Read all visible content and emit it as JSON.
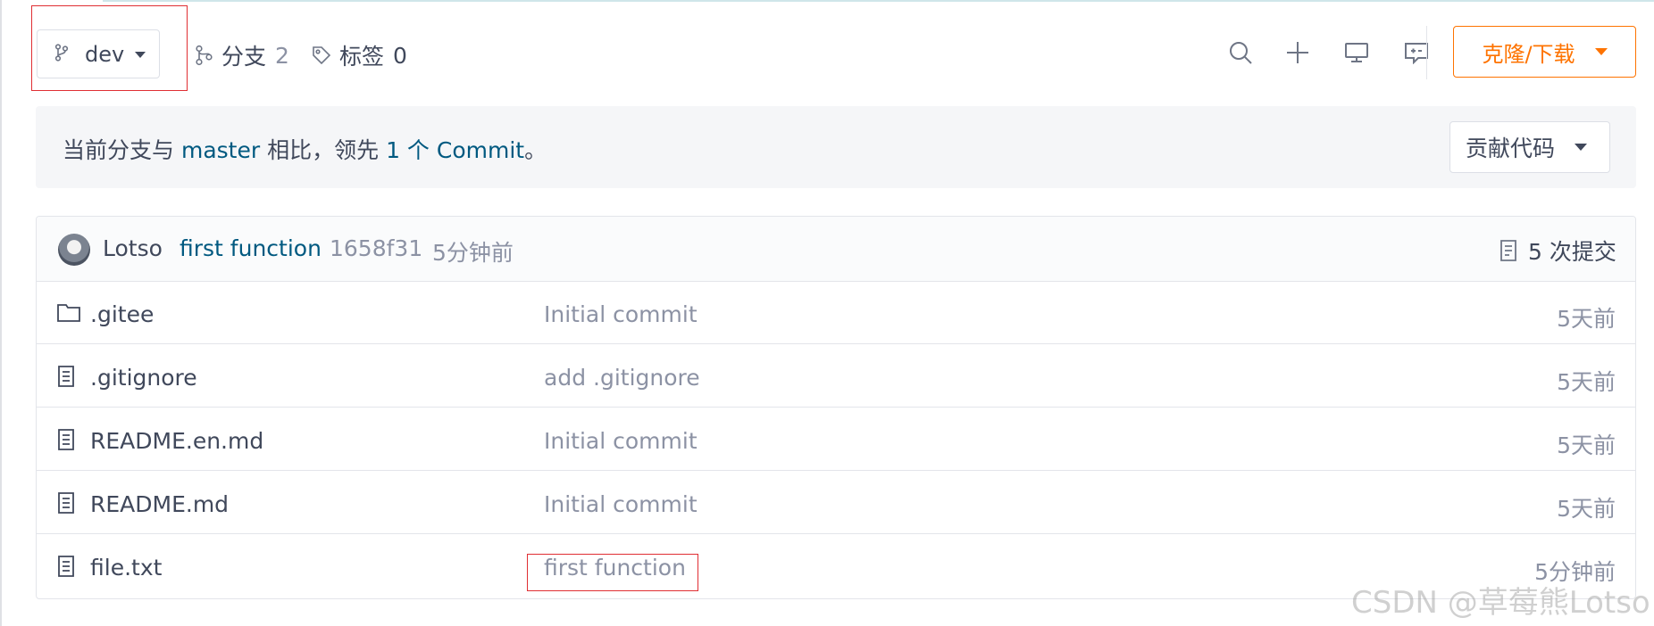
{
  "toolbar": {
    "branch": {
      "label": "dev"
    },
    "branches": {
      "label": "分支",
      "count": "2"
    },
    "tags": {
      "label": "标签",
      "count": "0"
    },
    "clone_label": "克隆/下载",
    "accent_color": "#fe7300"
  },
  "banner": {
    "prefix": "当前分支与",
    "base": "master",
    "middle": "相比，领先",
    "ahead": "1 个 Commit",
    "suffix": "。",
    "contribute_label": "贡献代码"
  },
  "last_commit": {
    "author": "Lotso",
    "message": "first function",
    "sha": "1658f31",
    "time": "5分钟前",
    "count_label": "5 次提交"
  },
  "files": [
    {
      "type": "folder",
      "name": ".gitee",
      "message": "Initial commit",
      "time": "5天前"
    },
    {
      "type": "file",
      "name": ".gitignore",
      "message": "add .gitignore",
      "time": "5天前"
    },
    {
      "type": "file",
      "name": "README.en.md",
      "message": "Initial commit",
      "time": "5天前"
    },
    {
      "type": "file",
      "name": "README.md",
      "message": "Initial commit",
      "time": "5天前"
    },
    {
      "type": "file",
      "name": "file.txt",
      "message": "first function",
      "time": "5分钟前"
    }
  ],
  "watermark": "CSDN @草莓熊Lotso",
  "icons": [
    "branch-icon",
    "tag-icon",
    "search-icon",
    "plus-icon",
    "monitor-icon",
    "comment-icon",
    "commit-log-icon",
    "folder-icon",
    "file-icon"
  ]
}
